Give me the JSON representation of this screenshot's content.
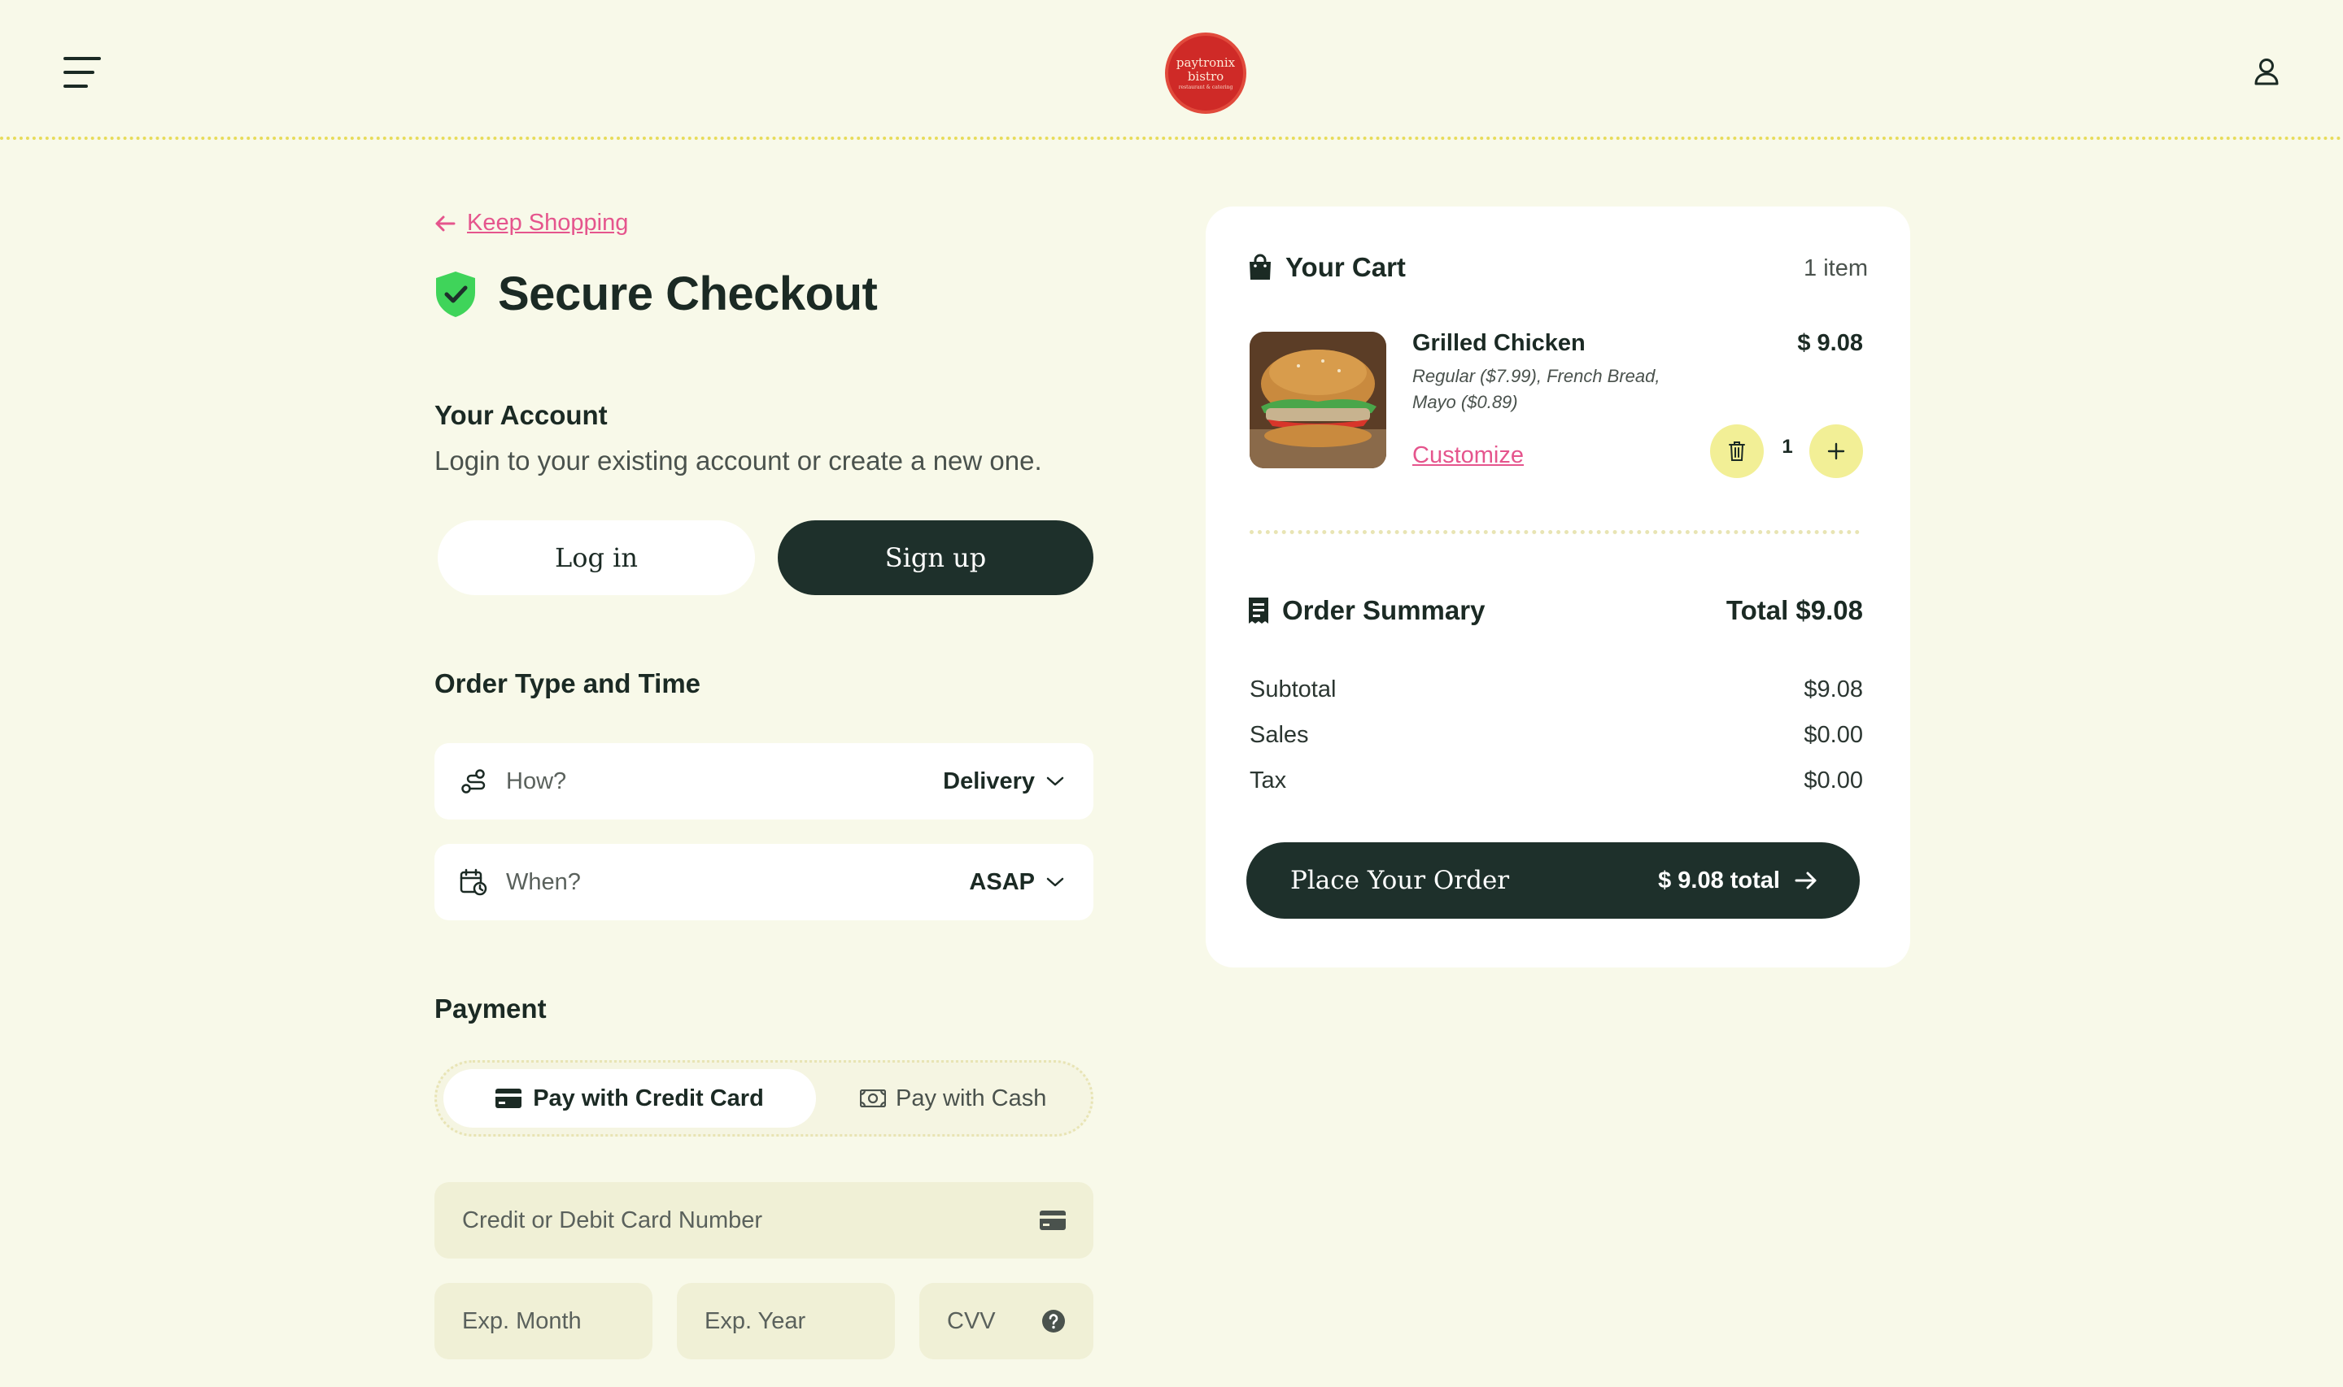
{
  "header": {
    "logo_line1": "paytronix",
    "logo_line2": "bistro",
    "logo_line3": "restaurant & catering"
  },
  "nav": {
    "keep_shopping": "Keep Shopping"
  },
  "page_title": "Secure Checkout",
  "account": {
    "heading": "Your Account",
    "description": "Login to your existing account or create a new one.",
    "login_label": "Log in",
    "signup_label": "Sign up"
  },
  "order_type": {
    "heading": "Order Type and Time",
    "how_placeholder": "How?",
    "how_value": "Delivery",
    "when_placeholder": "When?",
    "when_value": "ASAP"
  },
  "payment": {
    "heading": "Payment",
    "credit_label": "Pay with Credit Card",
    "cash_label": "Pay with Cash",
    "card_number_placeholder": "Credit or Debit Card Number",
    "exp_month_placeholder": "Exp. Month",
    "exp_year_placeholder": "Exp. Year",
    "cvv_placeholder": "CVV"
  },
  "cart": {
    "heading": "Your Cart",
    "count": "1 item",
    "item": {
      "name": "Grilled Chicken",
      "options": "Regular ($7.99), French Bread, Mayo ($0.89)",
      "price": "$ 9.08",
      "customize_label": "Customize",
      "quantity": "1"
    }
  },
  "summary": {
    "heading": "Order Summary",
    "total_label": "Total $9.08",
    "rows": [
      {
        "label": "Subtotal",
        "value": "$9.08"
      },
      {
        "label": "Sales",
        "value": "$0.00"
      },
      {
        "label": "Tax",
        "value": "$0.00"
      }
    ],
    "place_label": "Place Your Order",
    "place_total": "$ 9.08 total"
  },
  "colors": {
    "background": "#f8f9e9",
    "primary_dark": "#1e302b",
    "accent_pink": "#e5558d",
    "accent_yellow": "#f2ef96",
    "shield_green": "#3fd45a",
    "logo_red": "#cf2a27"
  }
}
